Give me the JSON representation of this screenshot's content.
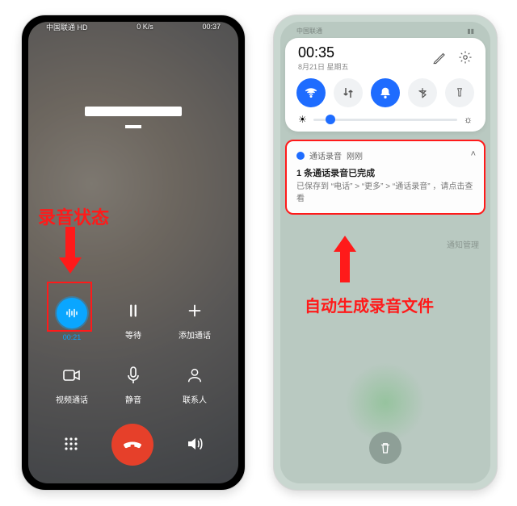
{
  "left": {
    "status": {
      "carrier": "中国联通 HD",
      "speed": "0 K/s",
      "time": "00:37"
    },
    "contact": {
      "name": " ",
      "sub": " "
    },
    "buttons": {
      "record": {
        "label": "00:21"
      },
      "hold": {
        "label": "等待"
      },
      "add": {
        "label": "添加通话"
      },
      "video": {
        "label": "视频通话"
      },
      "mute": {
        "label": "静音"
      },
      "contacts": {
        "label": "联系人"
      }
    },
    "annotation": "录音状态"
  },
  "right": {
    "status": {
      "carrier": "中国联通",
      "time": " "
    },
    "qs": {
      "time": "00:35",
      "date": "8月21日 星期五"
    },
    "notif": {
      "app": "通话录音",
      "when": "刚刚",
      "title": "1 条通话录音已完成",
      "body": "已保存到 “电话” > “更多” > “通话录音” ，请点击查看"
    },
    "manager": "通知管理",
    "annotation": "自动生成录音文件"
  }
}
